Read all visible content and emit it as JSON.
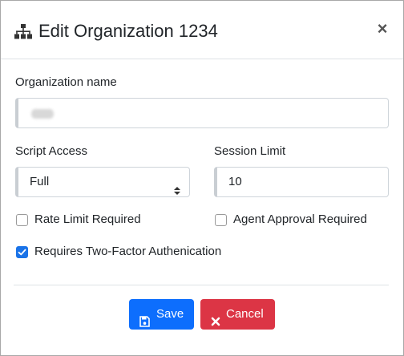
{
  "dialog": {
    "title": "Edit Organization 1234",
    "close_glyph": "×",
    "title_icon": "sitemap-icon"
  },
  "fields": {
    "org_name": {
      "label": "Organization name",
      "value": ""
    },
    "script_access": {
      "label": "Script Access",
      "value": "Full"
    },
    "session_limit": {
      "label": "Session Limit",
      "value": "10"
    }
  },
  "checkboxes": {
    "rate_limit": {
      "label": "Rate Limit Required",
      "checked": false
    },
    "agent_approval": {
      "label": "Agent Approval Required",
      "checked": false
    },
    "two_factor": {
      "label": "Requires Two-Factor Authenication",
      "checked": true
    }
  },
  "buttons": {
    "save": {
      "label": "Save",
      "icon": "floppy-disk-icon",
      "color": "#0d6efd"
    },
    "cancel": {
      "label": "Cancel",
      "icon": "x-icon",
      "color": "#dc3545"
    }
  },
  "colors": {
    "accent": "#1a73e8"
  }
}
